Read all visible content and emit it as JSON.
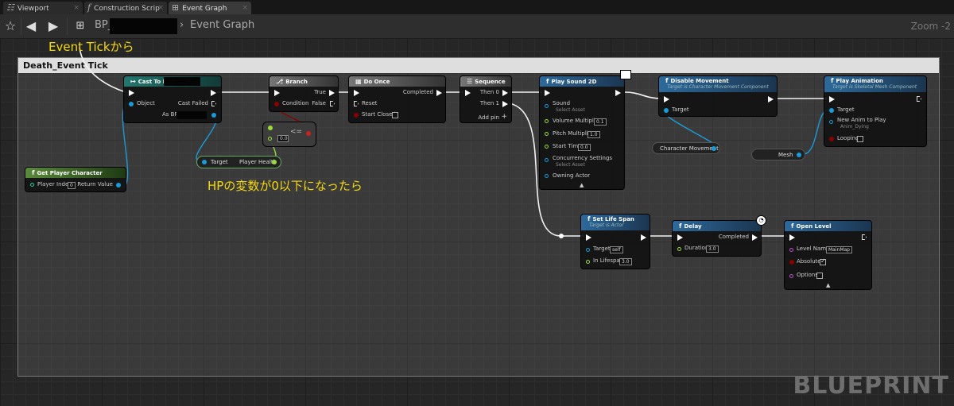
{
  "tabs": [
    {
      "label": "Viewport",
      "icon": "grid-icon"
    },
    {
      "label": "Construction Scrip",
      "icon": "function-icon"
    },
    {
      "label": "Event Graph",
      "icon": "graph-icon"
    }
  ],
  "toolbar": {
    "breadcrumb_root": "BP_",
    "breadcrumb_current": "Event Graph",
    "zoom": "Zoom -2"
  },
  "annotations": {
    "top": "Event Tickから",
    "middle": "HPの変数が0以下になったら"
  },
  "comment": {
    "title": "Death_Event Tick"
  },
  "nodes": {
    "cast": {
      "title": "Cast To BP",
      "pin_object": "Object",
      "pin_failed": "Cast Failed",
      "pin_as": "As BP"
    },
    "branch": {
      "title": "Branch",
      "pin_condition": "Condition",
      "pin_true": "True",
      "pin_false": "False"
    },
    "compare": {
      "op": "<=",
      "value": "0.0"
    },
    "doonce": {
      "title": "Do Once",
      "pin_completed": "Completed",
      "pin_reset": "Reset",
      "pin_start_closed": "Start Closed"
    },
    "sequence": {
      "title": "Sequence",
      "then0": "Then 0",
      "then1": "Then 1",
      "add_pin": "Add pin"
    },
    "playsound": {
      "title": "Play Sound 2D",
      "sound": "Sound",
      "sound_sel": "Select Asset",
      "volume": "Volume Multiplier",
      "volume_val": "0.1",
      "pitch": "Pitch Multiplier",
      "pitch_val": "1.0",
      "start": "Start Time",
      "start_val": "0.0",
      "concurrency": "Concurrency Settings",
      "conc_sel": "Select Asset",
      "owning": "Owning Actor"
    },
    "disable": {
      "title": "Disable Movement",
      "subtitle": "Target is Character Movement Component",
      "target": "Target"
    },
    "playanim": {
      "title": "Play Animation",
      "subtitle": "Target is Skeletal Mesh Component",
      "target": "Target",
      "new_anim": "New Anim to Play",
      "anim_sel": "Anim_Dying",
      "looping": "Looping"
    },
    "getplayer": {
      "title": "Get Player Character",
      "player_index": "Player Index",
      "player_index_val": "0",
      "return_value": "Return Value"
    },
    "playerhealth": {
      "target": "Target",
      "health": "Player Health"
    },
    "charmove": {
      "label": "Character Movement"
    },
    "mesh": {
      "label": "Mesh"
    },
    "lifespan": {
      "title": "Set Life Span",
      "subtitle": "Target is Actor",
      "target": "Target",
      "target_val": "self",
      "inlife": "In Lifespan",
      "inlife_val": "3.0"
    },
    "delay": {
      "title": "Delay",
      "completed": "Completed",
      "duration": "Duration",
      "duration_val": "3.0"
    },
    "openlevel": {
      "title": "Open Level",
      "level_name": "Level Name",
      "level_val": "MainMap",
      "absolute": "Absolute",
      "options": "Options"
    }
  },
  "watermark": "BLUEPRINT",
  "colors": {
    "exec_wire": "#ffffff",
    "object_wire": "#1a9bd7",
    "float_wire": "#9bdb3a",
    "bool_wire": "#8b0000",
    "annotation": "#f5d90f"
  }
}
